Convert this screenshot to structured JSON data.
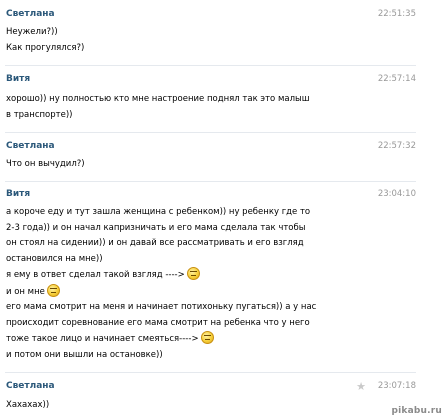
{
  "messages": [
    {
      "author": "Светлана",
      "time": "22:51:35",
      "lines": [
        "Неужели?))",
        "Как прогулялся?)"
      ]
    },
    {
      "author": "Витя",
      "time": "22:57:14",
      "lines": [
        "хорошо)) ну полностью кто мне настроение поднял так это малыш",
        "в транспорте))"
      ]
    },
    {
      "author": "Светлана",
      "time": "22:57:32",
      "lines": [
        "Что он вычудил?)"
      ]
    },
    {
      "author": "Витя",
      "time": "23:04:10",
      "lines": [
        "а короче еду и тут зашла женщина с ребенком)) ну ребенку где то",
        "2-3 года)) и он начал капризничать и его мама сделала так чтобы",
        "он стоял на сидении)) и он давай все рассматривать и его взгляд",
        "остановился на мне))",
        "я ему в ответ сделал такой взгляд ---->",
        "и он мне",
        "его мама смотрит на меня и начинает потихоньку пугаться)) а у нас",
        "происходит соревнование его мама смотрит на ребенка что у него",
        "тоже такое лицо и начинает смеяться---->",
        "и потом они вышли на остановке))"
      ]
    },
    {
      "author": "Светлана",
      "time": "23:07:18",
      "lines": [
        "Хахахах))"
      ]
    }
  ],
  "icons": {
    "smiley": "smiley-icon",
    "star": "star-icon"
  },
  "watermark": "pikabu.ru"
}
